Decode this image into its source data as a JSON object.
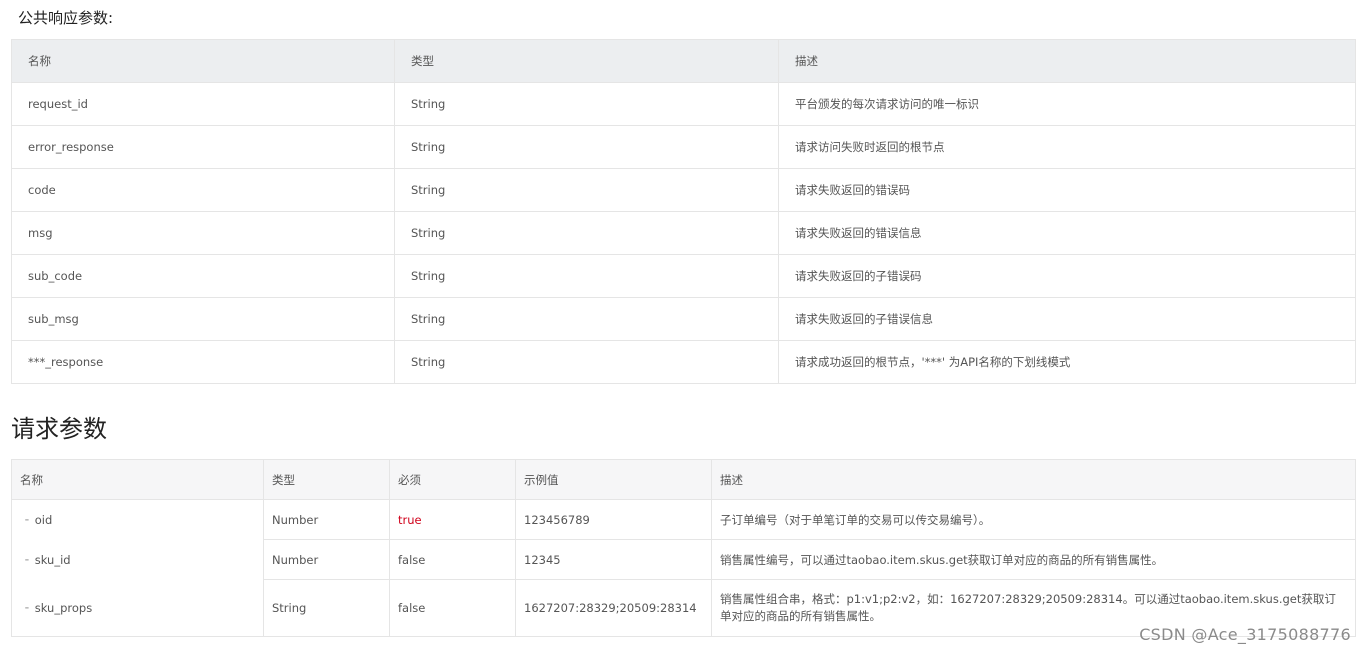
{
  "public_section": {
    "title": "公共响应参数:",
    "headers": [
      "名称",
      "类型",
      "描述"
    ],
    "rows": [
      {
        "name": "request_id",
        "type": "String",
        "desc": "平台颁发的每次请求访问的唯一标识"
      },
      {
        "name": "error_response",
        "type": "String",
        "desc": "请求访问失败时返回的根节点"
      },
      {
        "name": "code",
        "type": "String",
        "desc": "请求失败返回的错误码"
      },
      {
        "name": "msg",
        "type": "String",
        "desc": "请求失败返回的错误信息"
      },
      {
        "name": "sub_code",
        "type": "String",
        "desc": "请求失败返回的子错误码"
      },
      {
        "name": "sub_msg",
        "type": "String",
        "desc": "请求失败返回的子错误信息"
      },
      {
        "name": "***_response",
        "type": "String",
        "desc": "请求成功返回的根节点，'***' 为API名称的下划线模式"
      }
    ]
  },
  "request_section": {
    "title": "请求参数",
    "headers": [
      "名称",
      "类型",
      "必须",
      "示例值",
      "描述"
    ],
    "tree_mark": "⁃",
    "rows": [
      {
        "name": "oid",
        "type": "Number",
        "required": "true",
        "example": "123456789",
        "desc": "子订单编号（对于单笔订单的交易可以传交易编号）。"
      },
      {
        "name": "sku_id",
        "type": "Number",
        "required": "false",
        "example": "12345",
        "desc": "销售属性编号，可以通过taobao.item.skus.get获取订单对应的商品的所有销售属性。"
      },
      {
        "name": "sku_props",
        "type": "String",
        "required": "false",
        "example": "1627207:28329;20509:28314",
        "desc": "销售属性组合串，格式：p1:v1;p2:v2，如：1627207:28329;20509:28314。可以通过taobao.item.skus.get获取订单对应的商品的所有销售属性。"
      }
    ]
  },
  "watermark": "CSDN @Ace_3175088776",
  "colors": {
    "header_bg": "#eceef0",
    "border": "#e5e5e5",
    "required_true": "#d0021b"
  }
}
